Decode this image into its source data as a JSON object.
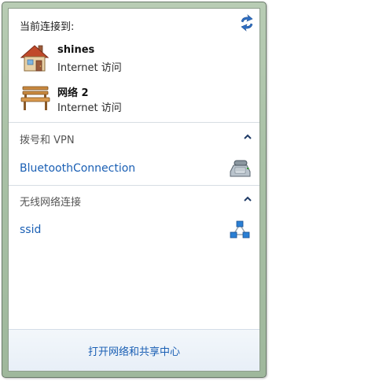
{
  "header": {
    "title": "当前连接到:",
    "refresh_icon": "refresh-icon"
  },
  "connections": [
    {
      "name": "shines",
      "status": "Internet 访问",
      "icon": "home-network-icon"
    },
    {
      "name": "网络  2",
      "status": "Internet 访问",
      "icon": "public-network-bench-icon"
    }
  ],
  "sections": {
    "dialup": {
      "title": "拨号和 VPN",
      "items": [
        {
          "label": "BluetoothConnection",
          "icon": "dialup-modem-icon"
        }
      ]
    },
    "wireless": {
      "title": "无线网络连接",
      "items": [
        {
          "label": "ssid",
          "icon": "adhoc-network-icon"
        }
      ]
    }
  },
  "footer": {
    "link_label": "打开网络和共享中心"
  },
  "colors": {
    "link": "#1a5fb4",
    "frame": "#a9c1a6",
    "separator": "#d7dde3"
  }
}
